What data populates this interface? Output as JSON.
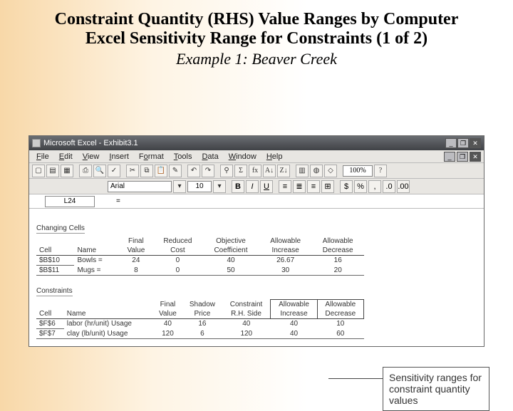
{
  "slide": {
    "title": "Constraint Quantity (RHS) Value Ranges by Computer",
    "sub1": "Excel Sensitivity Range for Constraints (1 of 2)",
    "sub2": "Example 1: Beaver Creek"
  },
  "titlebar": {
    "app": "Microsoft Excel",
    "doc": "Exhibit3.1"
  },
  "menus": [
    "File",
    "Edit",
    "View",
    "Insert",
    "Format",
    "Tools",
    "Data",
    "Window",
    "Help"
  ],
  "toolbar": {
    "zoom": "100%"
  },
  "format": {
    "font": "Arial",
    "size": "10"
  },
  "cellbar": {
    "name": "L24",
    "fx": "="
  },
  "changing": {
    "label": "Changing Cells",
    "headersTop": [
      "",
      "",
      "Final",
      "Reduced",
      "Objective",
      "Allowable",
      "Allowable"
    ],
    "headersBot": [
      "Cell",
      "Name",
      "Value",
      "Cost",
      "Coefficient",
      "Increase",
      "Decrease"
    ],
    "rows": [
      {
        "cell": "$B$10",
        "name": "Bowls =",
        "final": "24",
        "reduced": "0",
        "coef": "40",
        "inc": "26.67",
        "dec": "16"
      },
      {
        "cell": "$B$11",
        "name": "Mugs =",
        "final": "8",
        "reduced": "0",
        "coef": "50",
        "inc": "30",
        "dec": "20"
      }
    ]
  },
  "constraints": {
    "label": "Constraints",
    "headersTop": [
      "",
      "",
      "Final",
      "Shadow",
      "Constraint",
      "Allowable",
      "Allowable"
    ],
    "headersBot": [
      "Cell",
      "Name",
      "Value",
      "Price",
      "R.H. Side",
      "Increase",
      "Decrease"
    ],
    "rows": [
      {
        "cell": "$F$6",
        "name": "labor (hr/unit) Usage",
        "final": "40",
        "shadow": "16",
        "rhs": "40",
        "inc": "40",
        "dec": "10"
      },
      {
        "cell": "$F$7",
        "name": "clay (lb/unit) Usage",
        "final": "120",
        "shadow": "6",
        "rhs": "120",
        "inc": "40",
        "dec": "60"
      }
    ]
  },
  "callout": "Sensitivity ranges for constraint quantity values",
  "winbtns": {
    "min": "_",
    "max": "❐",
    "close": "✕"
  }
}
